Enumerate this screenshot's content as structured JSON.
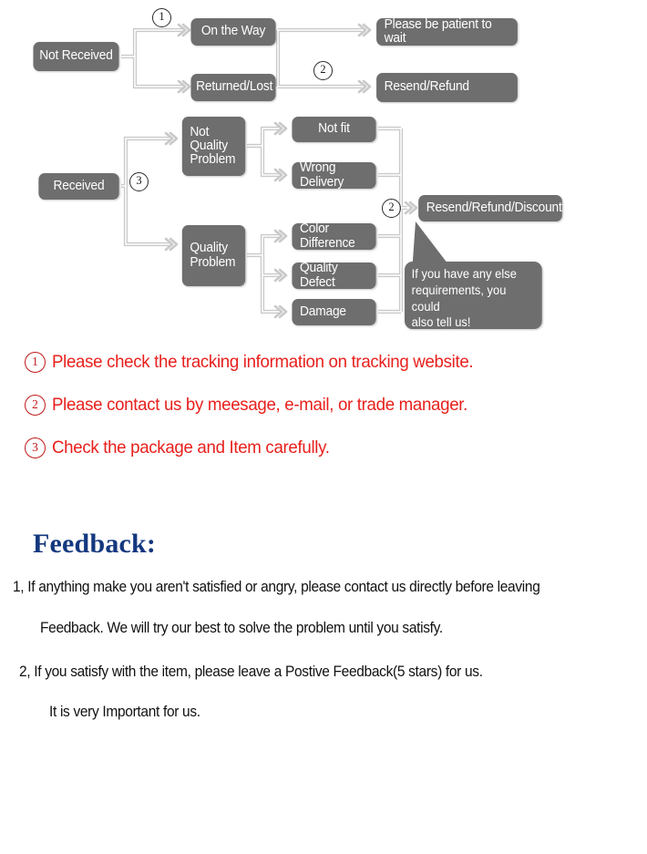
{
  "flowchart": {
    "nodes": {
      "not_received": "Not Received",
      "on_the_way": "On the Way",
      "returned_lost": "Returned/Lost",
      "please_wait": "Please be patient to wait",
      "resend_refund": "Resend/Refund",
      "received": "Received",
      "not_quality_problem": "Not\nQuality\nProblem",
      "not_quality_problem_lines": [
        "Not",
        "Quality",
        "Problem"
      ],
      "quality_problem_lines": [
        "Quality",
        "Problem"
      ],
      "not_fit": "Not fit",
      "wrong_delivery": "Wrong Delivery",
      "color_difference": "Color Difference",
      "quality_defect": "Quality Defect",
      "damage": "Damage",
      "resend_refund_discount": "Resend/Refund/Discount"
    },
    "callout": {
      "lines": [
        "If you have any else",
        "requirements, you could",
        "also tell us!"
      ]
    },
    "markers": {
      "one": "①",
      "two_top": "②",
      "three": "③",
      "two_right": "②"
    },
    "marker_digits": {
      "one": "1",
      "two_top": "2",
      "three": "3",
      "two_right": "2"
    },
    "colors": {
      "node_fill": "#6e6e6e",
      "connector": "#c9c9c9",
      "node_text": "#ffffff"
    }
  },
  "notes": {
    "items": [
      {
        "num": "1",
        "text": "Please check the tracking information on tracking website."
      },
      {
        "num": "2",
        "text": "Please contact us by meesage, e-mail, or trade manager."
      },
      {
        "num": "3",
        "text": "Check the package and Item carefully."
      }
    ],
    "color": "#e8201c"
  },
  "feedback": {
    "title": "Feedback:",
    "title_color": "#14387f",
    "lines": [
      "1, If anything make you aren't satisfied or angry, please contact us directly before leaving",
      "Feedback. We will try our best to solve the problem until you satisfy.",
      "2, If you satisfy with the item, please leave a Postive Feedback(5 stars) for us.",
      "It is very Important for us."
    ]
  }
}
